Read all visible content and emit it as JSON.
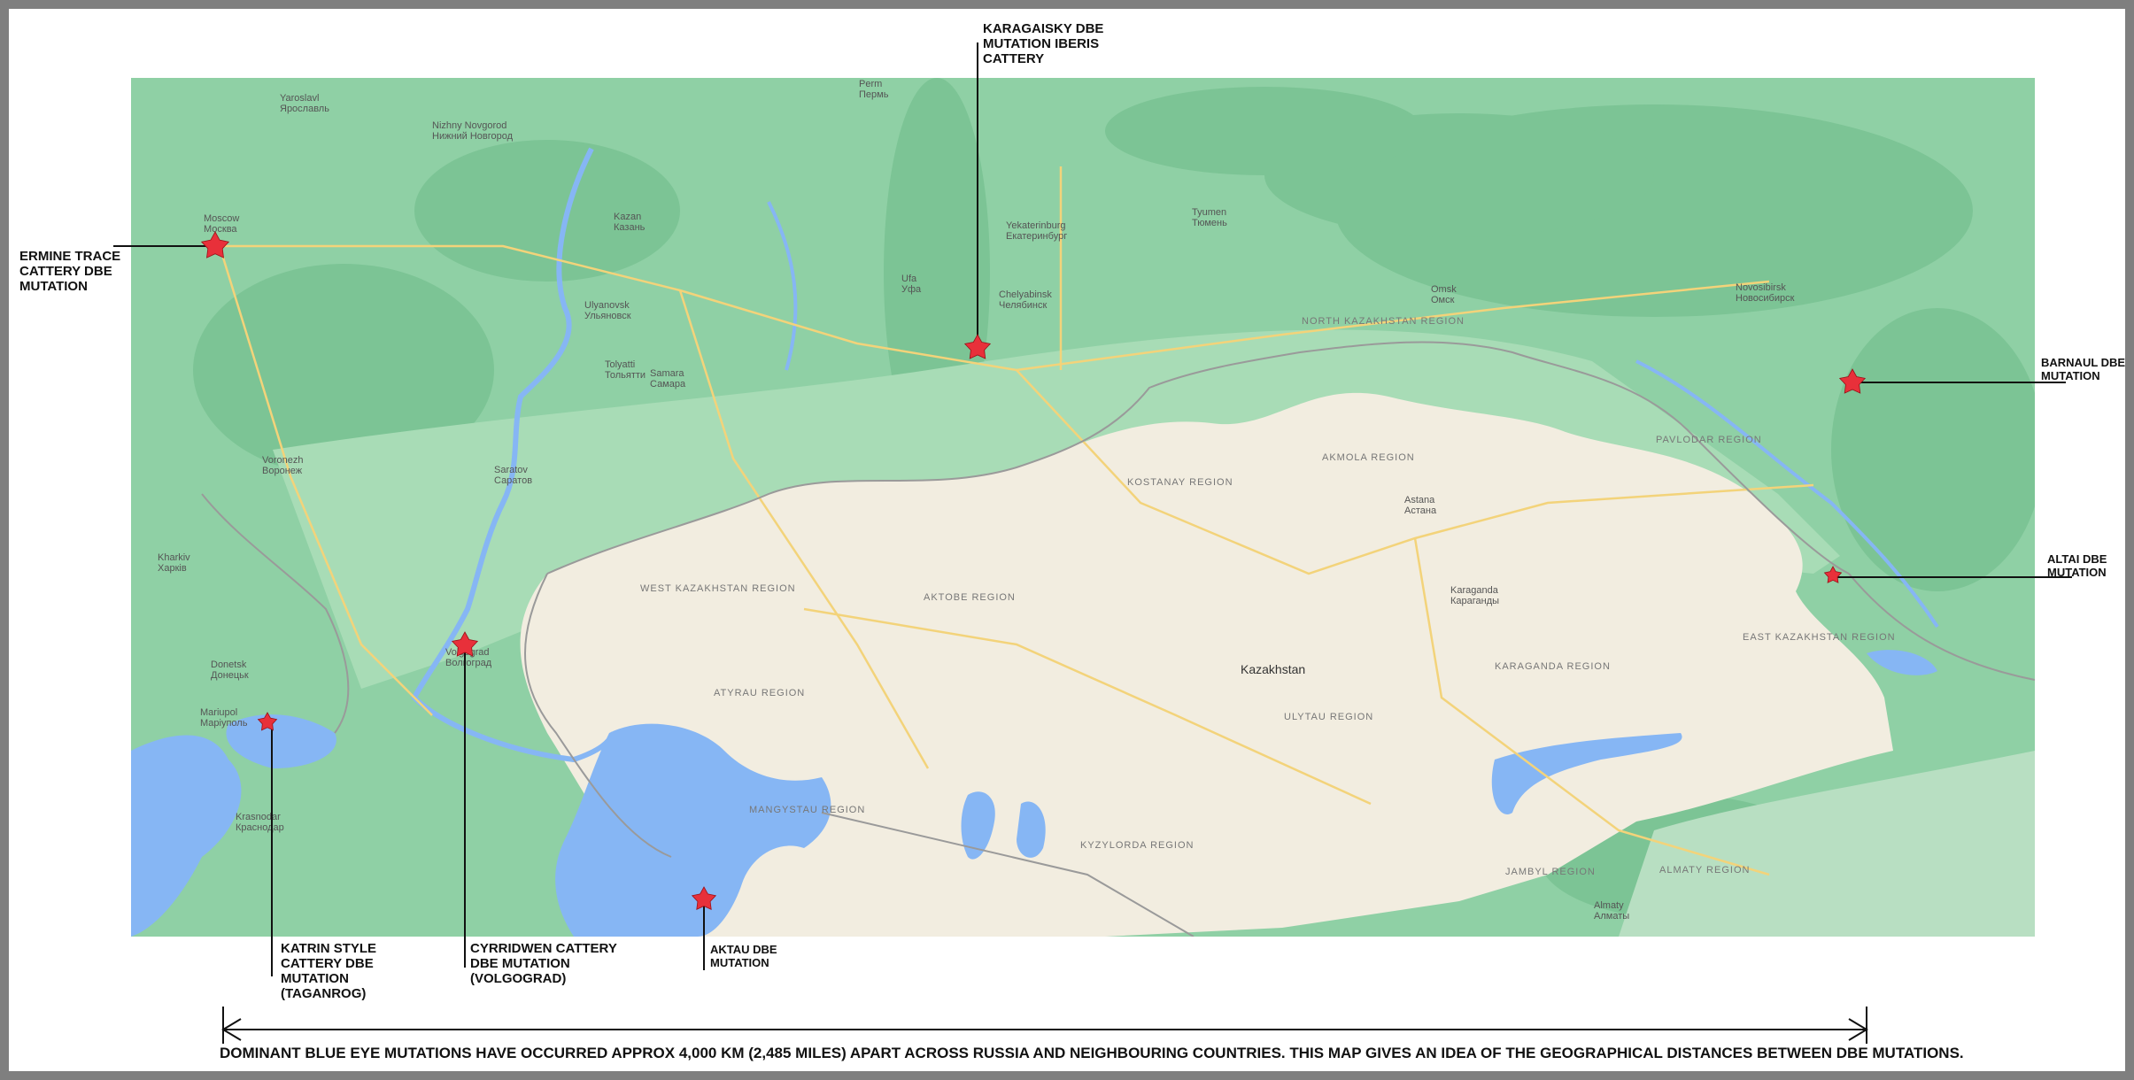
{
  "map": {
    "country_label": "Kazakhstan",
    "colors": {
      "forest": "#8fd0a5",
      "steppe": "#f2ede0",
      "water": "#86b6f4",
      "roads": "#f3d37a",
      "border": "#999999",
      "marker": "#e8303a"
    },
    "places": [
      {
        "name": "Moscow",
        "local": "Москва"
      },
      {
        "name": "Nizhny Novgorod",
        "local": "Нижний Новгород"
      },
      {
        "name": "Kazan",
        "local": "Казань"
      },
      {
        "name": "Ulyanovsk",
        "local": "Ульяновск"
      },
      {
        "name": "Tolyatti",
        "local": "Тольятти"
      },
      {
        "name": "Samara",
        "local": "Самара"
      },
      {
        "name": "Ufa",
        "local": "Уфа"
      },
      {
        "name": "Perm",
        "local": "Пермь"
      },
      {
        "name": "Yekaterinburg",
        "local": "Екатеринбург"
      },
      {
        "name": "Tyumen",
        "local": "Тюмень"
      },
      {
        "name": "Chelyabinsk",
        "local": "Челябинск"
      },
      {
        "name": "Omsk",
        "local": "Омск"
      },
      {
        "name": "Novosibirsk",
        "local": "Новосибирск"
      },
      {
        "name": "Voronezh",
        "local": "Воронеж"
      },
      {
        "name": "Saratov",
        "local": "Саратов"
      },
      {
        "name": "Kharkiv",
        "local": "Харків"
      },
      {
        "name": "Donetsk",
        "local": "Донецьк"
      },
      {
        "name": "Mariupol",
        "local": "Маріуполь"
      },
      {
        "name": "Volgograd",
        "local": "Волгоград"
      },
      {
        "name": "Krasnodar",
        "local": "Краснодар"
      },
      {
        "name": "Astana",
        "local": "Астана"
      },
      {
        "name": "Karaganda",
        "local": "Караганды"
      },
      {
        "name": "Almaty",
        "local": "Алматы"
      },
      {
        "name": "Yaroslavl",
        "local": "Ярославль"
      }
    ],
    "regions": [
      "NORTH KAZAKHSTAN REGION",
      "KOSTANAY REGION",
      "AKMOLA REGION",
      "PAVLODAR REGION",
      "WEST KAZAKHSTAN REGION",
      "AKTOBE REGION",
      "ATYRAU REGION",
      "KARAGANDA REGION",
      "EAST KAZAKHSTAN REGION",
      "MANGYSTAU REGION",
      "KYZYLORDA REGION",
      "ULYTAU REGION",
      "JAMBYL REGION",
      "ALMATY REGION"
    ]
  },
  "callouts": [
    {
      "id": "karagaisky",
      "text": "KARAGAISKY DBE\nMUTATION IBERIS\nCATTERY"
    },
    {
      "id": "ermine",
      "text": "ERMINE TRACE\nCATTERY DBE\nMUTATION"
    },
    {
      "id": "barnaul",
      "text": "BARNAUL DBE\nMUTATION"
    },
    {
      "id": "altai",
      "text": "ALTAI DBE\nMUTATION"
    },
    {
      "id": "katrin",
      "text": "KATRIN STYLE\nCATTERY DBE\nMUTATION\n(TAGANROG)"
    },
    {
      "id": "cyrridwen",
      "text": "CYRRIDWEN CATTERY\nDBE MUTATION\n(VOLGOGRAD)"
    },
    {
      "id": "aktau",
      "text": "AKTAU DBE\nMUTATION"
    }
  ],
  "caption": "DOMINANT BLUE EYE MUTATIONS HAVE OCCURRED APPROX 4,000 KM (2,485 MILES) APART ACROSS RUSSIA AND NEIGHBOURING COUNTRIES. THIS MAP GIVES AN IDEA OF THE GEOGRAPHICAL DISTANCES BETWEEN DBE MUTATIONS."
}
